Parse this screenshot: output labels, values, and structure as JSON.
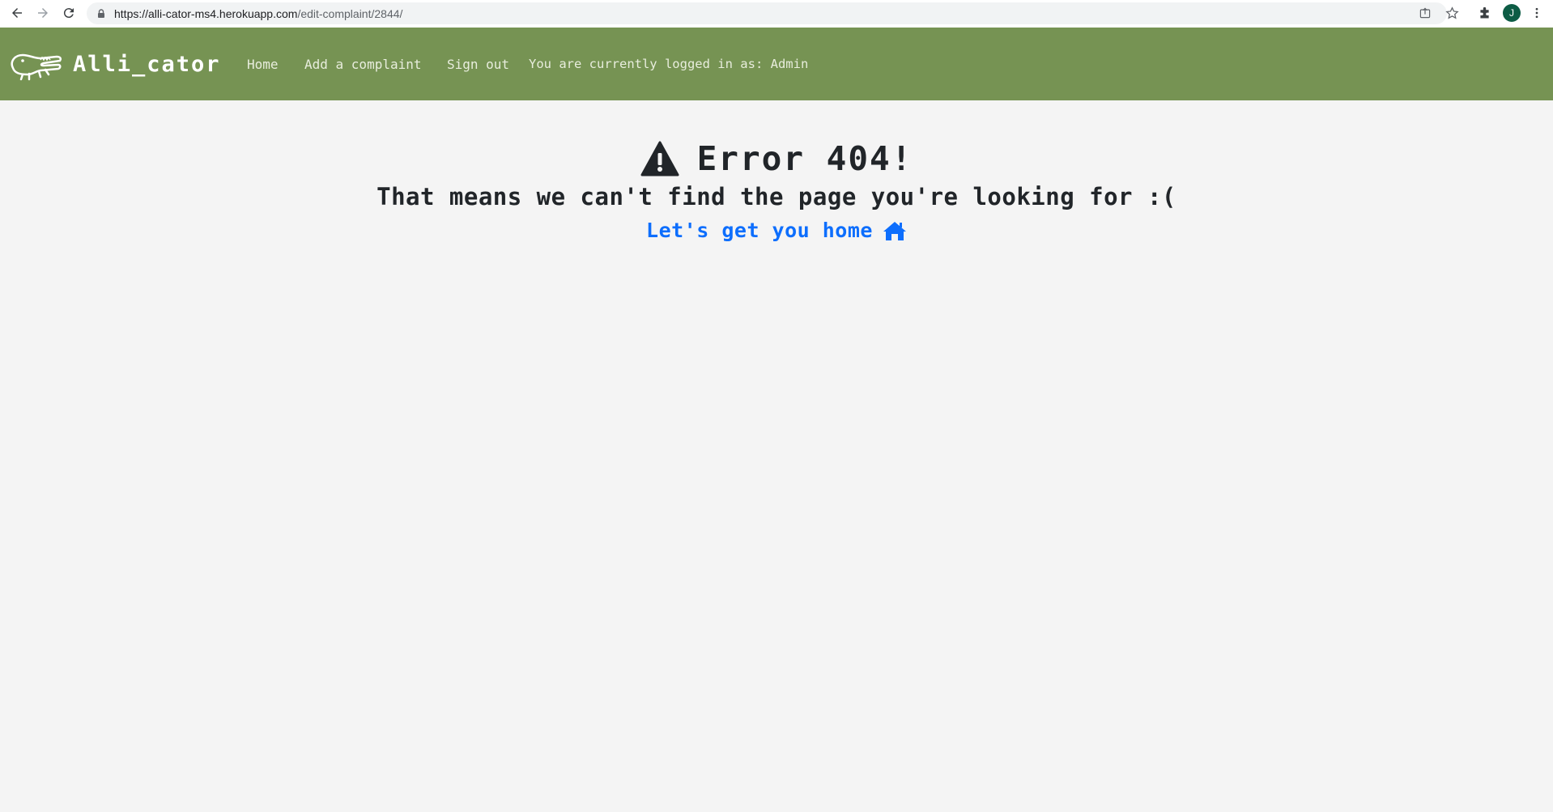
{
  "browser": {
    "url_host": "https://alli-cator-ms4.herokuapp.com",
    "url_path": "/edit-complaint/2844/",
    "profile_initial": "J"
  },
  "navbar": {
    "brand": "Alli_cator",
    "links": [
      {
        "label": "Home"
      },
      {
        "label": "Add a complaint"
      },
      {
        "label": "Sign out"
      }
    ],
    "status": "You are currently logged in as: Admin",
    "bg_color": "#769353"
  },
  "error": {
    "title": "Error 404!",
    "subtitle": "That means we can't find the page you're looking for :(",
    "home_link": "Let's get you home",
    "link_color": "#0d6efd"
  }
}
